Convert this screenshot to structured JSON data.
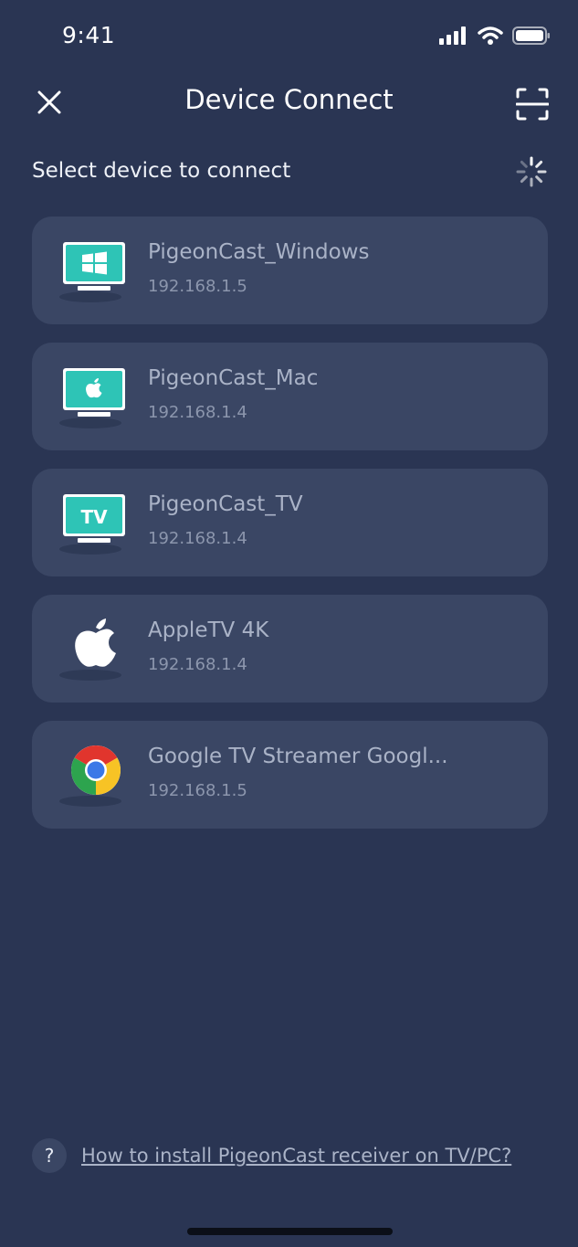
{
  "status_bar": {
    "time": "9:41"
  },
  "header": {
    "title": "Device Connect",
    "close_icon": "close-icon",
    "scan_icon": "scan-icon"
  },
  "section": {
    "title": "Select device to connect",
    "spinner_icon": "loading-spinner-icon"
  },
  "devices": [
    {
      "name": "PigeonCast_Windows",
      "ip": "192.168.1.5",
      "icon": "windows-monitor-icon"
    },
    {
      "name": "PigeonCast_Mac",
      "ip": "192.168.1.4",
      "icon": "mac-monitor-icon"
    },
    {
      "name": "PigeonCast_TV",
      "ip": "192.168.1.4",
      "icon": "tv-monitor-icon"
    },
    {
      "name": "AppleTV 4K",
      "ip": "192.168.1.4",
      "icon": "apple-icon"
    },
    {
      "name": "Google TV Streamer Googl...",
      "ip": "192.168.1.5",
      "icon": "chrome-icon"
    }
  ],
  "help": {
    "icon_text": "?",
    "link_text": "How to install PigeonCast receiver on TV/PC?"
  },
  "colors": {
    "background": "#2a3553",
    "card": "#3a4664",
    "monitor_teal": "#2ec4b6",
    "text_primary": "#ffffff",
    "text_secondary": "#aab3c7"
  }
}
